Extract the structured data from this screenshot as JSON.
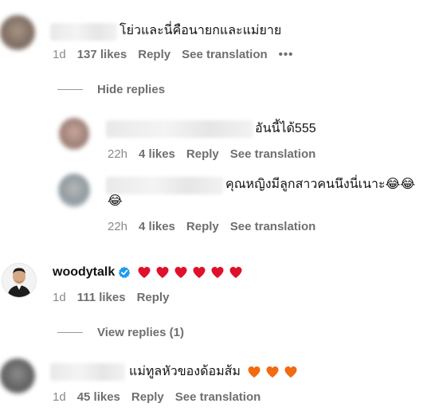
{
  "comments": [
    {
      "text": "โย่วและนี่คือนายกและแม่ยาย",
      "time": "1d",
      "likes": "137 likes",
      "reply": "Reply",
      "translate": "See translation",
      "more": "•••"
    }
  ],
  "replies_toggle_1": "Hide replies",
  "replies": [
    {
      "text": "อันนี้ได้555",
      "time": "22h",
      "likes": "4 likes",
      "reply": "Reply",
      "translate": "See translation"
    },
    {
      "text": "คุณหญิงมีลูกสาวคนนึงนี่เนาะ😂😂",
      "text_line2": "😂",
      "time": "22h",
      "likes": "4 likes",
      "reply": "Reply",
      "translate": "See translation"
    }
  ],
  "woody": {
    "username": "woodytalk",
    "heart_count": 6,
    "heart_color": "#e0112b",
    "time": "1d",
    "likes": "111 likes",
    "reply": "Reply",
    "verified_color": "#1d9bf0"
  },
  "replies_toggle_2": "View replies (1)",
  "last": {
    "text": "แม่ทูลหัวของด้อมส้ม",
    "heart_count": 3,
    "heart_color": "#f26a11",
    "time": "1d",
    "likes": "45 likes",
    "reply": "Reply",
    "translate": "See translation"
  }
}
